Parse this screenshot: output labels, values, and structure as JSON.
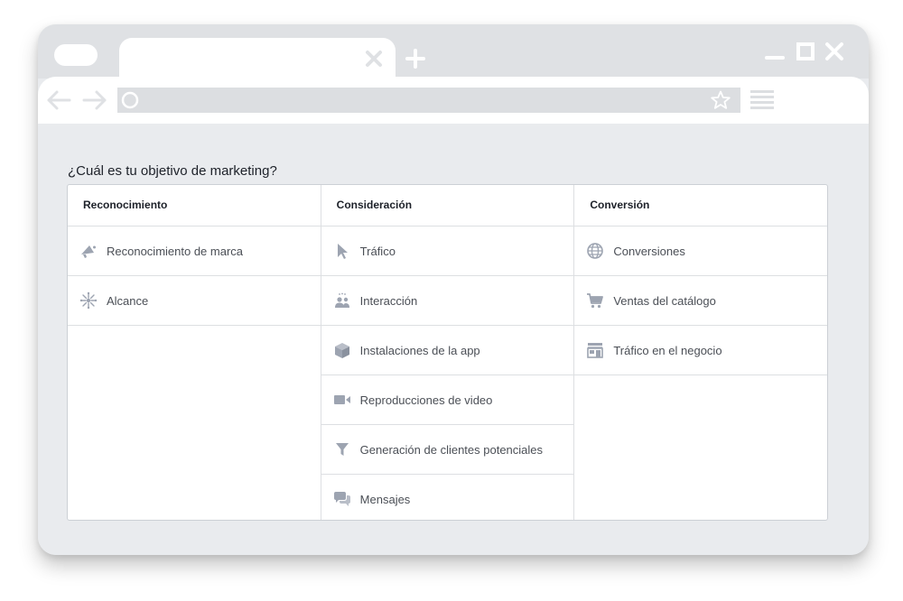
{
  "page": {
    "question": "¿Cuál es tu objetivo de marketing?"
  },
  "colors": {
    "window_frame": "#e9ebee",
    "titlebar": "#dfe1e4",
    "icon_gray": "#9da4b1",
    "text_dark": "#1d2129",
    "text_item": "#4b4f56"
  },
  "columns": [
    {
      "header": "Reconocimiento",
      "items": [
        {
          "label": "Reconocimiento de marca",
          "icon": "megaphone-icon"
        },
        {
          "label": "Alcance",
          "icon": "reach-burst-icon"
        }
      ]
    },
    {
      "header": "Consideración",
      "items": [
        {
          "label": "Tráfico",
          "icon": "cursor-icon"
        },
        {
          "label": "Interacción",
          "icon": "people-icon"
        },
        {
          "label": "Instalaciones de la app",
          "icon": "app-box-icon"
        },
        {
          "label": "Reproducciones de video",
          "icon": "video-camera-icon"
        },
        {
          "label": "Generación de clientes potenciales",
          "icon": "funnel-icon"
        },
        {
          "label": "Mensajes",
          "icon": "chat-bubbles-icon"
        }
      ]
    },
    {
      "header": "Conversión",
      "items": [
        {
          "label": "Conversiones",
          "icon": "globe-icon"
        },
        {
          "label": "Ventas del catálogo",
          "icon": "shopping-cart-icon"
        },
        {
          "label": "Tráfico en el negocio",
          "icon": "store-icon"
        }
      ]
    }
  ]
}
